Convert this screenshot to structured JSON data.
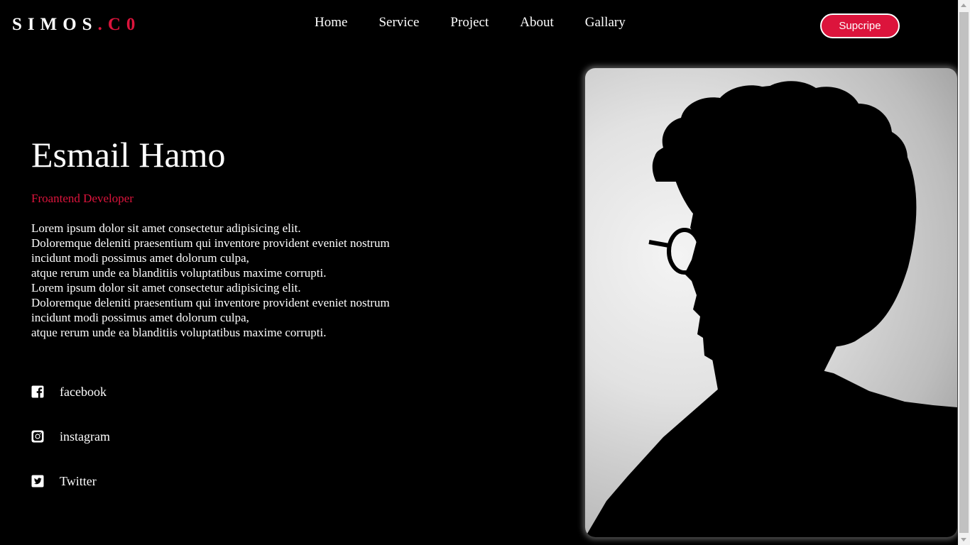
{
  "header": {
    "logo_main": "SIMOS",
    "logo_accent": ".C0",
    "nav": [
      "Home",
      "Service",
      "Project",
      "About",
      "Gallary"
    ],
    "subscribe_label": "Supcripe"
  },
  "hero": {
    "name": "Esmail Hamo",
    "role": "Froantend Developer",
    "description_lines": [
      "Lorem ipsum dolor sit amet consectetur adipisicing elit.",
      "Doloremque deleniti praesentium qui inventore provident eveniet nostrum",
      "incidunt modi possimus amet dolorum culpa,",
      "atque rerum unde ea blanditiis voluptatibus maxime corrupti.",
      "Lorem ipsum dolor sit amet consectetur adipisicing elit.",
      "Doloremque deleniti praesentium qui inventore provident eveniet nostrum",
      "incidunt modi possimus amet dolorum culpa,",
      "atque rerum unde ea blanditiis voluptatibus maxime corrupti."
    ]
  },
  "social": [
    {
      "label": "facebook",
      "icon": "facebook-icon"
    },
    {
      "label": "instagram",
      "icon": "instagram-icon"
    },
    {
      "label": "Twitter",
      "icon": "twitter-icon"
    }
  ],
  "colors": {
    "background": "#000000",
    "accent": "#dc143c",
    "text": "#ffffff"
  }
}
